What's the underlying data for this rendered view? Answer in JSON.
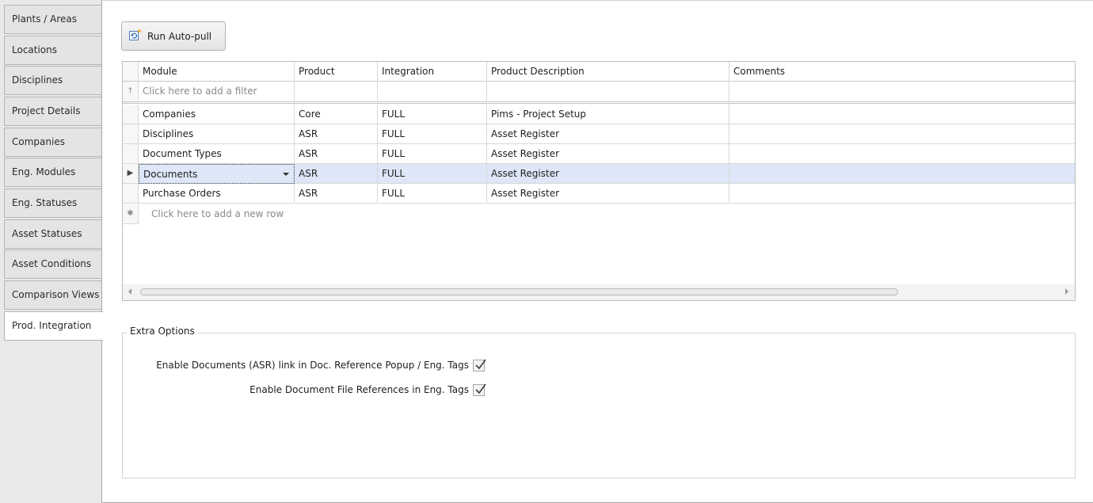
{
  "tabs": [
    {
      "label": "Plants / Areas"
    },
    {
      "label": "Locations"
    },
    {
      "label": "Disciplines"
    },
    {
      "label": "Project Details"
    },
    {
      "label": "Companies"
    },
    {
      "label": "Eng. Modules"
    },
    {
      "label": "Eng. Statuses"
    },
    {
      "label": "Asset Statuses"
    },
    {
      "label": "Asset Conditions"
    },
    {
      "label": "Comparison Views"
    },
    {
      "label": "Prod. Integration",
      "active": true
    }
  ],
  "toolbar": {
    "run_autopull_label": "Run Auto-pull",
    "run_autopull_icon": "refresh-sparkle-icon"
  },
  "grid": {
    "columns": [
      "Module",
      "Product",
      "Integration",
      "Product Description",
      "Comments"
    ],
    "filter_placeholder": "Click here to add a filter",
    "rows": [
      [
        "Companies",
        "Core",
        "FULL",
        "Pims - Project Setup",
        ""
      ],
      [
        "Disciplines",
        "ASR",
        "FULL",
        "Asset Register",
        ""
      ],
      [
        "Document Types",
        "ASR",
        "FULL",
        "Asset Register",
        ""
      ],
      [
        "Documents",
        "ASR",
        "FULL",
        "Asset Register",
        ""
      ],
      [
        "Purchase Orders",
        "ASR",
        "FULL",
        "Asset Register",
        ""
      ]
    ],
    "selected_row": "Documents",
    "new_row_placeholder": "Click here to add a new row",
    "filter_row_glyph": "†",
    "new_row_glyph": "✱",
    "current_row_glyph": "▶"
  },
  "extra_options": {
    "title": "Extra Options",
    "options": [
      {
        "label": "Enable Documents (ASR) link in Doc. Reference Popup / Eng. Tags",
        "checked": true
      },
      {
        "label": "Enable Document File References in Eng. Tags",
        "checked": true
      }
    ]
  },
  "colors": {
    "selected_row": "#dde7f7",
    "tab_bg": "#e4e4e4",
    "border": "#bcbcbc"
  }
}
